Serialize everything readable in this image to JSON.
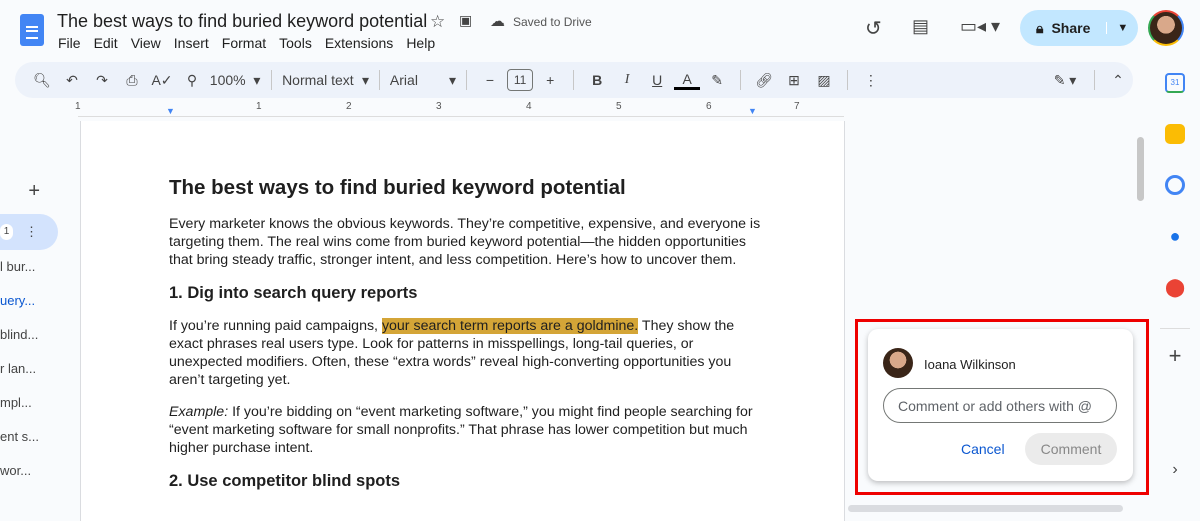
{
  "header": {
    "title": "The best ways to find buried keyword potential",
    "saved": "Saved to Drive",
    "menu": [
      "File",
      "Edit",
      "View",
      "Insert",
      "Format",
      "Tools",
      "Extensions",
      "Help"
    ],
    "share": "Share"
  },
  "toolbar": {
    "zoom": "100%",
    "style": "Normal text",
    "font": "Arial",
    "size": "11",
    "minus": "−",
    "plus": "+",
    "bold": "B",
    "italic": "I",
    "underline": "U",
    "color": "A"
  },
  "ruler": [
    "1",
    "1",
    "2",
    "3",
    "4",
    "5",
    "6",
    "7"
  ],
  "outline": {
    "badge": "1",
    "items": [
      "l bur...",
      "uery...",
      "blind...",
      "r lan...",
      "mpl...",
      "ent s...",
      "wor..."
    ]
  },
  "doc": {
    "h1": "The best ways to find buried keyword potential",
    "p1": "Every marketer knows the obvious keywords. They’re competitive, expensive, and everyone is targeting them. The real wins come from buried keyword potential—the hidden opportunities that bring steady traffic, stronger intent, and less competition. Here’s how to uncover them.",
    "h2a": "1. Dig into search query reports",
    "p2a": "If you’re running paid campaigns, ",
    "p2hl": "your search term reports are a goldmine.",
    "p2b": " They show the exact phrases real users type. Look for patterns in misspellings, long-tail queries, or unexpected modifiers. Often, these “extra words” reveal high-converting opportunities you aren’t targeting yet.",
    "p3em": "Example:",
    "p3": " If you’re bidding on “event marketing software,” you might find people searching for “event marketing software for small nonprofits.” That phrase has lower competition but much higher purchase intent.",
    "h2b": "2. Use competitor blind spots"
  },
  "comment": {
    "user": "Ioana Wilkinson",
    "placeholder": "Comment or add others with @",
    "cancel": "Cancel",
    "submit": "Comment"
  },
  "side": {
    "calendar_day": "31"
  },
  "colors": {
    "accent": "#0b57d0",
    "highlight": "#d4a537",
    "share_bg": "#c2e7ff"
  }
}
